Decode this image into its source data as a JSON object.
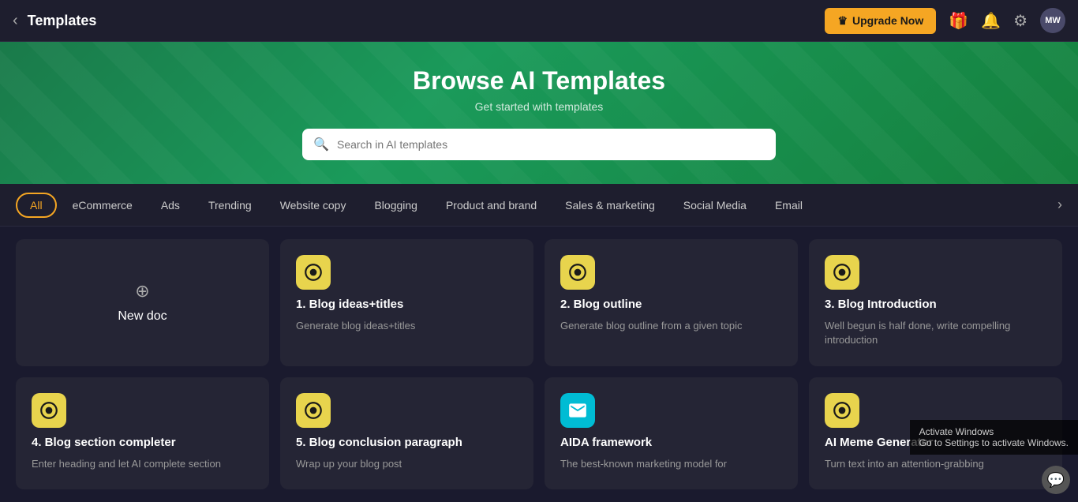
{
  "header": {
    "back_icon": "‹",
    "title": "Templates",
    "upgrade_label": "Upgrade Now",
    "crown_icon": "♛",
    "gift_icon": "🎁",
    "bell_icon": "🔔",
    "settings_icon": "⚙",
    "avatar_label": "MW"
  },
  "banner": {
    "title": "Browse AI Templates",
    "subtitle": "Get started with templates",
    "search_placeholder": "Search in AI templates"
  },
  "categories": [
    {
      "id": "all",
      "label": "All",
      "active": true
    },
    {
      "id": "ecommerce",
      "label": "eCommerce",
      "active": false
    },
    {
      "id": "ads",
      "label": "Ads",
      "active": false
    },
    {
      "id": "trending",
      "label": "Trending",
      "active": false
    },
    {
      "id": "website-copy",
      "label": "Website copy",
      "active": false
    },
    {
      "id": "blogging",
      "label": "Blogging",
      "active": false
    },
    {
      "id": "product-brand",
      "label": "Product and brand",
      "active": false
    },
    {
      "id": "sales-marketing",
      "label": "Sales & marketing",
      "active": false
    },
    {
      "id": "social-media",
      "label": "Social Media",
      "active": false
    },
    {
      "id": "email",
      "label": "Email",
      "active": false
    }
  ],
  "cards": [
    {
      "id": "new-doc",
      "type": "new",
      "label": "New doc"
    },
    {
      "id": "blog-ideas",
      "type": "template",
      "icon_type": "yellow",
      "icon_char": "✦",
      "title": "1. Blog ideas+titles",
      "desc": "Generate blog ideas+titles"
    },
    {
      "id": "blog-outline",
      "type": "template",
      "icon_type": "yellow",
      "icon_char": "✦",
      "title": "2. Blog outline",
      "desc": "Generate blog outline from a given topic"
    },
    {
      "id": "blog-intro",
      "type": "template",
      "icon_type": "yellow",
      "icon_char": "✦",
      "title": "3. Blog Introduction",
      "desc": "Well begun is half done, write compelling introduction"
    },
    {
      "id": "blog-section",
      "type": "template",
      "icon_type": "yellow",
      "icon_char": "✦",
      "title": "4. Blog section completer",
      "desc": "Enter heading and let AI complete section"
    },
    {
      "id": "blog-conclusion",
      "type": "template",
      "icon_type": "yellow",
      "icon_char": "✦",
      "title": "5. Blog conclusion paragraph",
      "desc": "Wrap up your blog post"
    },
    {
      "id": "aida",
      "type": "template",
      "icon_type": "cyan",
      "icon_char": "✉",
      "title": "AIDA framework",
      "desc": "The best-known marketing model for"
    },
    {
      "id": "meme",
      "type": "template",
      "icon_type": "yellow",
      "icon_char": "✦",
      "title": "AI Meme Generator",
      "desc": "Turn text into an attention-grabbing"
    }
  ],
  "activate_windows": "Activate Windows\nGo to Settings to activate Windows.",
  "new_doc_plus": "⊕"
}
